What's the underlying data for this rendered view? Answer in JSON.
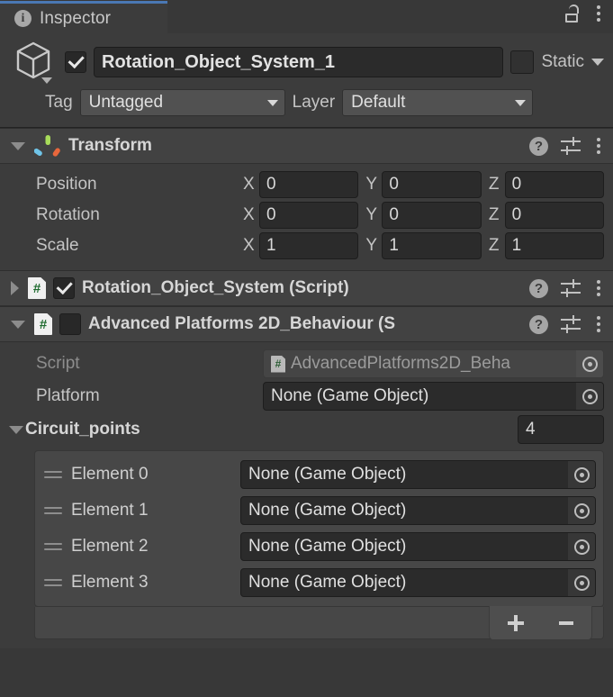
{
  "window": {
    "tab_label": "Inspector",
    "tab_icon": "info-icon",
    "lock_icon": "lock-open-icon",
    "menu_icon": "kebab-menu-icon",
    "accent_color": "#4a78b4",
    "background_color": "#383838",
    "panel_color": "#3c3c3c"
  },
  "gameobject": {
    "icon": "cube-icon",
    "enabled_checkbox": "checked",
    "name": "Rotation_Object_System_1",
    "static_checkbox": "unchecked",
    "static_label": "Static",
    "tag_label": "Tag",
    "tag_value": "Untagged",
    "layer_label": "Layer",
    "layer_value": "Default"
  },
  "transform": {
    "title": "Transform",
    "expanded": true,
    "icon": "transform-gizmo-icon",
    "help_icon": "help-icon",
    "preset_icon": "preset-settings-icon",
    "menu_icon": "kebab-menu-icon",
    "rows": [
      {
        "label": "Position",
        "x": "0",
        "y": "0",
        "z": "0"
      },
      {
        "label": "Rotation",
        "x": "0",
        "y": "0",
        "z": "0"
      },
      {
        "label": "Scale",
        "x": "1",
        "y": "1",
        "z": "1"
      }
    ],
    "axis_labels": {
      "x": "X",
      "y": "Y",
      "z": "Z"
    }
  },
  "components": [
    {
      "title": "Rotation_Object_System (Script)",
      "expanded": false,
      "enabled": "checked"
    },
    {
      "title": "Advanced Platforms 2D_Behaviour (S",
      "expanded": true,
      "enabled": "unchecked"
    }
  ],
  "script_component": {
    "script_label": "Script",
    "script_value": "AdvancedPlatforms2D_Beha",
    "platform_label": "Platform",
    "platform_value": "None (Game Object)",
    "array": {
      "label": "Circuit_points",
      "size": "4",
      "expanded": true,
      "elements": [
        {
          "label": "Element 0",
          "value": "None (Game Object)"
        },
        {
          "label": "Element 1",
          "value": "None (Game Object)"
        },
        {
          "label": "Element 2",
          "value": "None (Game Object)"
        },
        {
          "label": "Element 3",
          "value": "None (Game Object)"
        }
      ],
      "add_button": "+",
      "remove_button": "−"
    }
  }
}
